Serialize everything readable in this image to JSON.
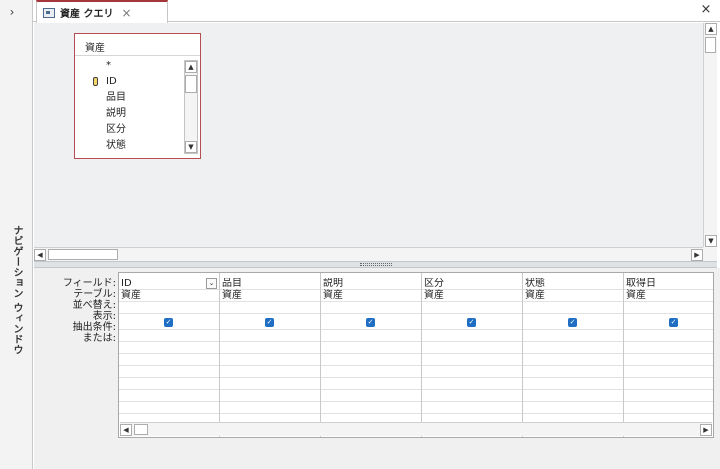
{
  "nav_pane": {
    "label": "ナビゲーション ウィンドウ",
    "expand_glyph": "›"
  },
  "tab": {
    "label": "資産 クエリ",
    "close_glyph": "×",
    "document_close_glyph": "×"
  },
  "table_box": {
    "title": "資産",
    "fields": [
      "*",
      "ID",
      "品目",
      "説明",
      "区分",
      "状態"
    ]
  },
  "design_grid": {
    "row_labels": [
      "フィールド:",
      "テーブル:",
      "並べ替え:",
      "表示:",
      "抽出条件:",
      "または:"
    ],
    "columns": [
      {
        "field": "ID",
        "table": "資産",
        "show": true
      },
      {
        "field": "品目",
        "table": "資産",
        "show": true
      },
      {
        "field": "説明",
        "table": "資産",
        "show": true
      },
      {
        "field": "区分",
        "table": "資産",
        "show": true
      },
      {
        "field": "状態",
        "table": "資産",
        "show": true
      },
      {
        "field": "取得日",
        "table": "資産",
        "show": true
      }
    ],
    "checkmark_glyph": "✓"
  },
  "scroll": {
    "up": "▲",
    "down": "▼",
    "left": "◀",
    "right": "▶"
  },
  "colors": {
    "accent": "#a4373a",
    "checkbox": "#1f6ec4"
  }
}
